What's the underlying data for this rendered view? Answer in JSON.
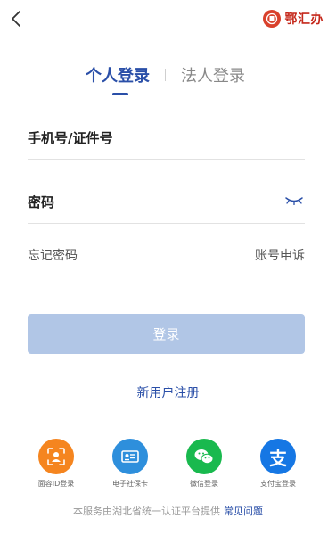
{
  "header": {
    "back_icon": "chevron-left-icon",
    "logo_text": "鄂汇办",
    "logo_color": "#d9412c"
  },
  "tabs": {
    "personal": "个人登录",
    "legal": "法人登录",
    "active": "personal",
    "active_color": "#2a4fa8"
  },
  "form": {
    "phone_label": "手机号/证件号",
    "password_label": "密码",
    "password_icon": "eye-closed-icon"
  },
  "links": {
    "forgot_password": "忘记密码",
    "account_appeal": "账号申诉"
  },
  "login_button": {
    "label": "登录",
    "color": "#b1c6e6"
  },
  "register": "新用户注册",
  "alt_login": [
    {
      "label": "面容ID登录",
      "icon": "face-id-icon",
      "color": "#f5851f"
    },
    {
      "label": "电子社保卡",
      "icon": "id-card-icon",
      "color": "#2e8fdc"
    },
    {
      "label": "微信登录",
      "icon": "wechat-icon",
      "color": "#19b94e"
    },
    {
      "label": "支付宝登录",
      "icon": "alipay-icon",
      "color": "#1677e4"
    }
  ],
  "footer": {
    "text": "本服务由湖北省统一认证平台提供",
    "link": "常见问题"
  }
}
